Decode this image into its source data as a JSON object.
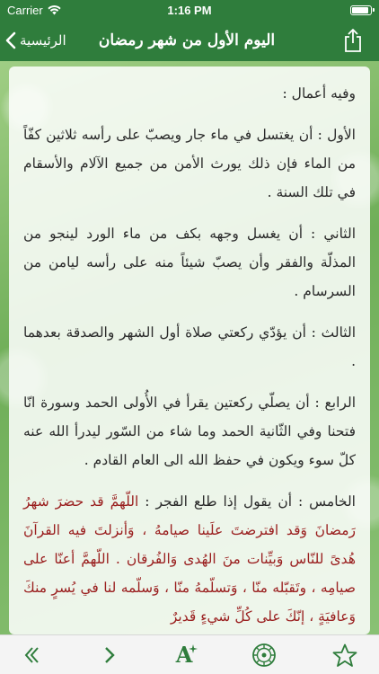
{
  "status_bar": {
    "carrier": "Carrier",
    "time": "1:16 PM"
  },
  "nav": {
    "title": "اليوم الأول من شهر رمضان",
    "back_label": "الرئيسية"
  },
  "content": {
    "intro": "وفيه أعمال :",
    "paragraphs": [
      "الأول : أن يغتسل في ماء جار ويصبّ على رأسه ثلاثين كفّاً من الماء فإن ذلك يورث الأمن من جميع الآلام والأسقام في تلك السنة .",
      "الثاني : أن يغسل وجهه بكف من ماء الورد لينجو من المذلّة والفقر وأن يصبّ شيئاً منه على رأسه ليامن من السرسام .",
      "الثالث : أن يؤدّي ركعتي صلاة أول الشهر والصدقة بعدهما .",
      "الرابع : أن يصلّي ركعتين يقرأ في الأُولى الحمد وسورة انّا فتحنا وفي الثّانية الحمد وما شاء من السّور ليدرأ الله عنه كلّ سوء ويكون في حفظ الله الى العام القادم ."
    ],
    "fifth_intro": "الخامس : أن يقول إذا طلع الفجر :",
    "fifth_prayer": "اللّهمَّ قد حضرَ شهرُ رَمضانَ وَقد افترضتَ علَينا صيامهُ ، وَأنزلتَ فيه القرآنَ هُدىً للنّاس وَبيِّنات منَ الهُدى وَالفُرقان . اللّهمَّ أعنّا على صيامِه ، وتَقبّله منّا ، وَتسلّمهُ منّا ، وَسلّمه لنا في يُسرٍ منكَ وَعافيَةٍ ، إنّكَ على كُلِّ شيءٍ قَديرٌ"
  },
  "colors": {
    "bar_green": "#2f7d3c",
    "text_dark": "#2b2b2b",
    "prayer_red": "#9a1f1f",
    "icon_green": "#2f7d3c"
  },
  "toolbar": {
    "font_button_glyph": "A",
    "icons": [
      "chevron-left-icon",
      "chevron-right-icon",
      "font-size-icon",
      "ornament-icon",
      "star-icon"
    ]
  }
}
